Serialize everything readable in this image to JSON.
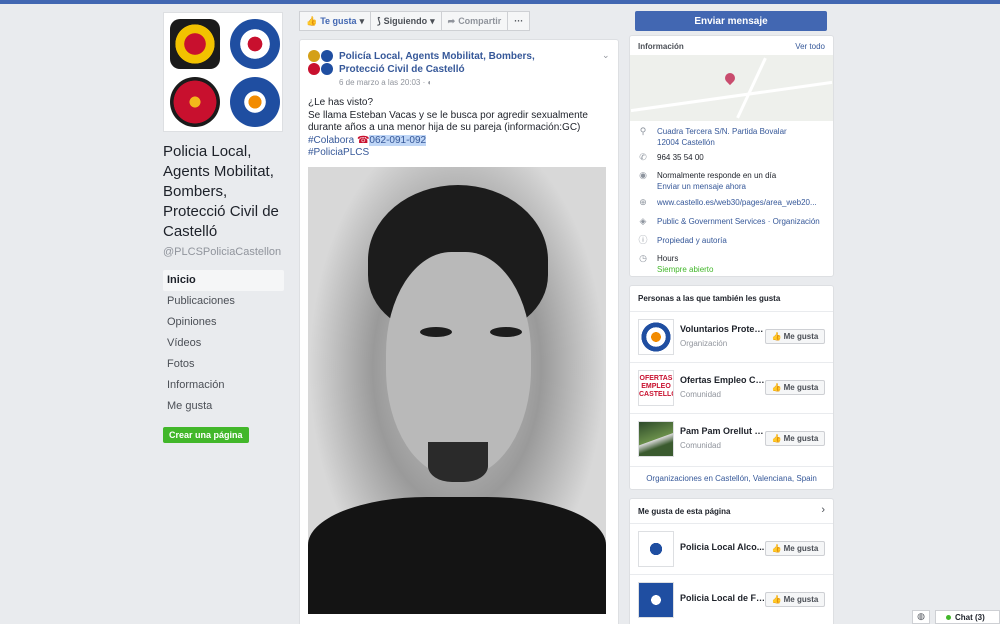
{
  "left": {
    "page_name": "Policia Local, Agents Mobilitat, Bombers, Protecció Civil de Castelló",
    "handle": "@PLCSPoliciaCastellon",
    "nav": [
      "Inicio",
      "Publicaciones",
      "Opiniones",
      "Vídeos",
      "Fotos",
      "Información",
      "Me gusta"
    ],
    "create_page": "Crear una página"
  },
  "actions": {
    "like": "Te gusta",
    "following": "Siguiendo",
    "share": "Compartir",
    "more": "···",
    "send_message": "Enviar mensaje"
  },
  "post": {
    "author": "Policía Local, Agents Mobilitat, Bombers, Protecció Civil de Castelló",
    "time": "6 de marzo a las 20:03 ·",
    "line1": "¿Le has visto?",
    "line2": "Se llama Esteban Vacas y se le busca por agredir sexualmente durante años a una menor hija de su pareja (información:GC)",
    "hashtag1": "#Colabora",
    "phone": "062-091-092",
    "hashtag2": "#PoliciaPLCS"
  },
  "info": {
    "title": "Información",
    "see_all": "Ver todo",
    "address_line1": "Cuadra Tercera S/N. Partida Bovalar",
    "address_line2": "12004 Castellón",
    "phone": "964 35 54 00",
    "response": "Normalmente responde en un día",
    "send_now": "Enviar un mensaje ahora",
    "website": "www.castello.es/web30/pages/area_web20...",
    "category": "Public & Government Services · Organización",
    "owner": "Propiedad y autoría",
    "hours": "Hours",
    "open": "Siempre abierto"
  },
  "also_like": {
    "title": "Personas a las que también les gusta",
    "items": [
      {
        "name": "Voluntarios Protecc...",
        "cat": "Organización"
      },
      {
        "name": "Ofertas Empleo Cas...",
        "cat": "Comunidad"
      },
      {
        "name": "Pam Pam Orellut Ho...",
        "cat": "Comunidad"
      }
    ],
    "footer": "Organizaciones en Castellón, Valenciana, Spain",
    "like_label": "Me gusta"
  },
  "page_likes": {
    "title": "Me gusta de esta página",
    "items": [
      {
        "name": "Policia Local Alco..."
      },
      {
        "name": "Policia Local de Fu..."
      }
    ],
    "like_label": "Me gusta"
  },
  "chat": {
    "label": "Chat (3)"
  },
  "ofertas_thumb": "OFERTAS EMPLEO CASTELLON",
  "colors": {
    "brand": "#4267b2",
    "link": "#365899",
    "green": "#42b72a"
  }
}
